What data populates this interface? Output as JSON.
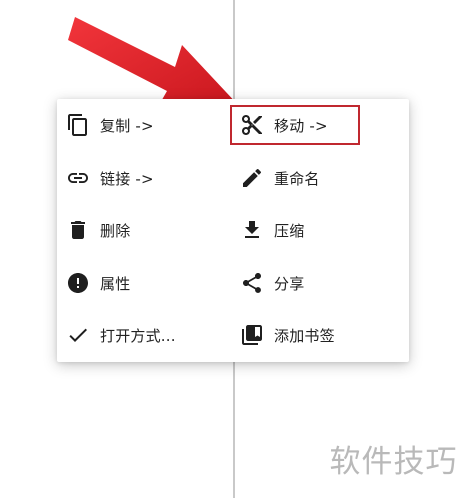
{
  "context_menu": {
    "left_items": [
      {
        "label": "复制 ->",
        "icon": "copy-icon"
      },
      {
        "label": "链接 ->",
        "icon": "link-icon"
      },
      {
        "label": "删除",
        "icon": "trash-icon"
      },
      {
        "label": "属性",
        "icon": "info-icon"
      },
      {
        "label": "打开方式...",
        "icon": "check-icon"
      }
    ],
    "right_items": [
      {
        "label": "移动 ->",
        "icon": "scissors-icon",
        "highlighted": true
      },
      {
        "label": "重命名",
        "icon": "pencil-icon"
      },
      {
        "label": "压缩",
        "icon": "download-icon"
      },
      {
        "label": "分享",
        "icon": "share-icon"
      },
      {
        "label": "添加书签",
        "icon": "bookmark-icon"
      }
    ]
  },
  "annotation": {
    "arrow_color": "#e8262d",
    "highlight_color": "#c0282f"
  },
  "watermark": {
    "text": "软件技巧"
  }
}
